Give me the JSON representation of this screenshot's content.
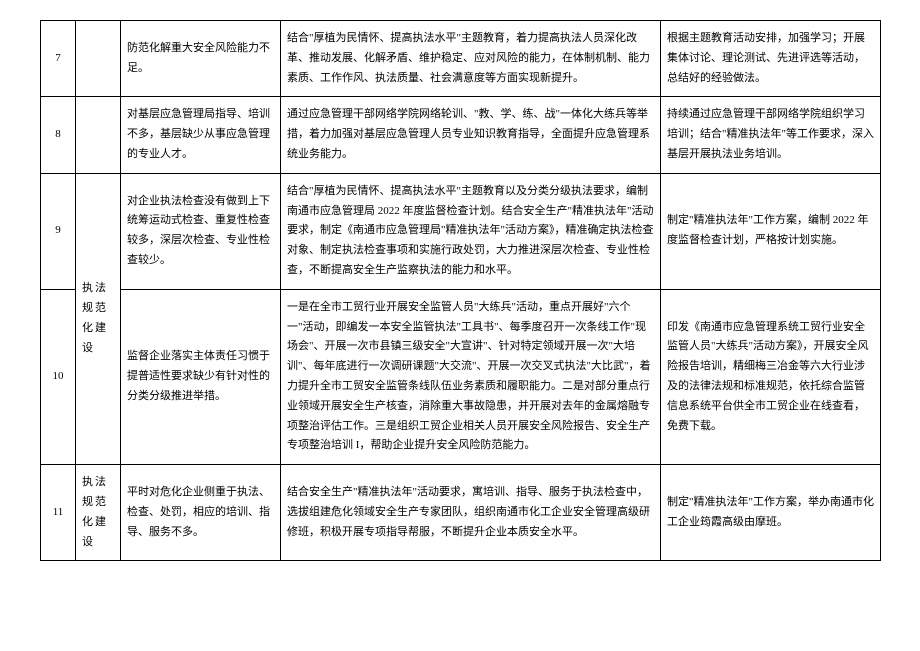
{
  "rows": [
    {
      "num": "7",
      "cat": "",
      "issue": "防范化解重大安全风险能力不足。",
      "plan": "结合\"厚植为民情怀、提高执法水平\"主题教育，着力提高执法人员深化改革、推动发展、化解矛盾、维护稳定、应对风险的能力，在体制机制、能力素质、工作作风、执法质量、社会满意度等方面实现新提升。",
      "progress": "根据主题教育活动安排，加强学习；开展集体讨论、理论测试、先进评选等活动，总结好的经验做法。"
    },
    {
      "num": "8",
      "cat": "",
      "issue": "对基层应急管理局指导、培训不多，基层缺少从事应急管理的专业人才。",
      "plan": "通过应急管理干部网络学院网络轮训、\"教、学、练、战\"一体化大练兵等举措，着力加强对基层应急管理人员专业知识教育指导，全面提升应急管理系统业务能力。",
      "progress": "持续通过应急管理干部网络学院组织学习培训；结合\"精准执法年\"等工作要求，深入基层开展执法业务培训。"
    },
    {
      "num": "9",
      "cat": "执法规范化建设",
      "issue": "对企业执法检查没有做到上下统筹运动式检查、重复性检查较多，深层次检查、专业性检查较少。",
      "plan": "结合\"厚植为民情怀、提高执法水平\"主题教育以及分类分级执法要求，编制南通市应急管理局 2022 年度监督检查计划。结合安全生产\"精准执法年\"活动要求，制定《南通市应急管理局\"精准执法年\"活动方案》，精准确定执法检查对象、制定执法检查事项和实施行政处罚，大力推进深层次检查、专业性检查，不断提高安全生产监察执法的能力和水平。",
      "progress": "制定\"精准执法年\"工作方案，编制 2022 年度监督检查计划，严格按计划实施。"
    },
    {
      "num": "10",
      "cat": "",
      "issue": "监督企业落实主体责任习惯于提普适性要求缺少有针对性的分类分级推进举措。",
      "plan": "一是在全市工贸行业开展安全监管人员\"大练兵\"活动，重点开展好\"六个一\"活动，即编发一本安全监管执法\"工具书\"、每季度召开一次条线工作\"现场会\"、开展一次市县镇三级安全\"大宣讲\"、针对特定领域开展一次\"大培训\"、每年底进行一次调研课题\"大交流\"、开展一次交叉式执法\"大比武\"，着力提升全市工贸安全监管条线队伍业务素质和履职能力。二是对部分重点行业领域开展安全生产核查，消除重大事故隐患，并开展对去年的金属熔融专项整治评估工作。三是组织工贸企业相关人员开展安全风险报告、安全生产专项整治培训 I，帮助企业提升安全风险防范能力。",
      "progress": "印发《南通市应急管理系统工贸行业安全监管人员\"大练兵\"活动方案》，开展安全风险报告培训，精细梅三冶金等六大行业涉及的法律法规和标准规范，依托综合监管信息系统平台供全市工贸企业在线查看，免费下载。"
    },
    {
      "num": "11",
      "cat": "执法规范化建设",
      "issue": "平时对危化企业侧重于执法、检查、处罚，相应的培训、指导、服务不多。",
      "plan": "结合安全生产\"精准执法年\"活动要求，寓培训、指导、服务于执法检查中，选拔组建危化领域安全生产专家团队，组织南通市化工企业安全管理高级研修班，积极开展专项指导帮服，不断提升企业本质安全水平。",
      "progress": "制定\"精准执法年\"工作方案，举办南通市化工企业筠霞高级由摩班。"
    }
  ]
}
